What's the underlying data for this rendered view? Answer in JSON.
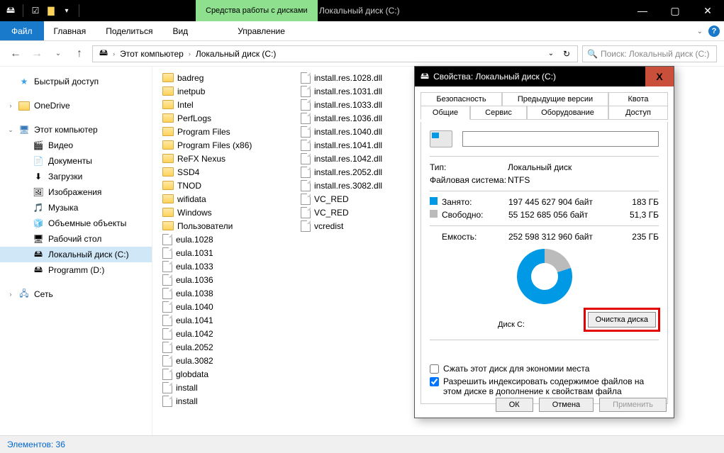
{
  "titlebar": {
    "context_tab": "Средства работы с дисками",
    "title": "Локальный диск (C:)"
  },
  "ribbon": {
    "file": "Файл",
    "tabs": [
      "Главная",
      "Поделиться",
      "Вид"
    ],
    "context_tab": "Управление"
  },
  "address": {
    "segments": [
      "Этот компьютер",
      "Локальный диск (C:)"
    ],
    "search_placeholder": "Поиск: Локальный диск (C:)"
  },
  "nav": {
    "quick": "Быстрый доступ",
    "onedrive": "OneDrive",
    "thispc": "Этот компьютер",
    "pc_items": [
      "Видео",
      "Документы",
      "Загрузки",
      "Изображения",
      "Музыка",
      "Объемные объекты",
      "Рабочий стол",
      "Локальный диск (C:)",
      "Programm (D:)"
    ],
    "network": "Сеть"
  },
  "files_col1": [
    "badreg",
    "inetpub",
    "Intel",
    "PerfLogs",
    "Program Files",
    "Program Files (x86)",
    "ReFX Nexus",
    "SSD4",
    "TNOD",
    "wifidata",
    "Windows",
    "Пользователи",
    "eula.1028",
    "eula.1031",
    "eula.1033",
    "eula.1036",
    "eula.1038",
    "eula.1040",
    "eula.1041",
    "eula.1042",
    "eula.2052",
    "eula.3082",
    "globdata",
    "install",
    "install"
  ],
  "files_col1_folders": 12,
  "files_col2": [
    "install.res.1028.dll",
    "install.res.1031.dll",
    "install.res.1033.dll",
    "install.res.1036.dll",
    "install.res.1040.dll",
    "install.res.1041.dll",
    "install.res.1042.dll",
    "install.res.2052.dll",
    "install.res.3082.dll",
    "VC_RED",
    "VC_RED",
    "vcredist"
  ],
  "status": "Элементов: 36",
  "dialog": {
    "title": "Свойства: Локальный диск (C:)",
    "tabs_row1": [
      "Безопасность",
      "Предыдущие версии",
      "Квота"
    ],
    "tabs_row2": [
      "Общие",
      "Сервис",
      "Оборудование",
      "Доступ"
    ],
    "type_lbl": "Тип:",
    "type_val": "Локальный диск",
    "fs_lbl": "Файловая система:",
    "fs_val": "NTFS",
    "used_lbl": "Занято:",
    "used_bytes": "197 445 627 904 байт",
    "used_gb": "183 ГБ",
    "free_lbl": "Свободно:",
    "free_bytes": "55 152 685 056 байт",
    "free_gb": "51,3 ГБ",
    "cap_lbl": "Емкость:",
    "cap_bytes": "252 598 312 960 байт",
    "cap_gb": "235 ГБ",
    "drive_label": "Диск C:",
    "cleanup": "Очистка диска",
    "compress": "Сжать этот диск для экономии места",
    "index": "Разрешить индексировать содержимое файлов на этом диске в дополнение к свойствам файла",
    "ok": "ОК",
    "cancel": "Отмена",
    "apply": "Применить"
  },
  "chart_data": {
    "type": "pie",
    "title": "Диск C:",
    "series": [
      {
        "name": "Занято",
        "value": 197445627904,
        "display": "183 ГБ",
        "color": "#0099e5"
      },
      {
        "name": "Свободно",
        "value": 55152685056,
        "display": "51,3 ГБ",
        "color": "#bbbbbb"
      }
    ],
    "total": {
      "name": "Емкость",
      "value": 252598312960,
      "display": "235 ГБ"
    }
  }
}
